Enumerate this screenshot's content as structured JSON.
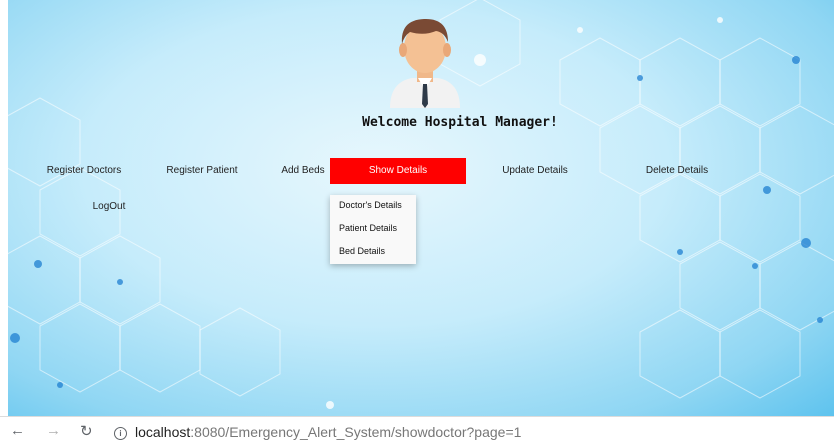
{
  "page": {
    "welcome_text": "Welcome Hospital Manager!"
  },
  "nav": {
    "register_doctors": "Register Doctors",
    "register_patient": "Register Patient",
    "add_beds": "Add Beds",
    "show_details": "Show Details",
    "update_details": "Update Details",
    "delete_details": "Delete Details",
    "logout": "LogOut"
  },
  "dropdown": {
    "items": [
      "Doctor's Details",
      "Patient Details",
      "Bed Details"
    ]
  },
  "browser": {
    "url_host": "localhost",
    "url_rest": ":8080/Emergency_Alert_System/showdoctor?page=1",
    "back_icon": "back-arrow-icon",
    "forward_icon": "forward-arrow-icon",
    "reload_icon": "reload-icon",
    "info_icon": "info-icon"
  },
  "colors": {
    "active_nav": "#ff0000",
    "background": "#c6ecfb"
  }
}
